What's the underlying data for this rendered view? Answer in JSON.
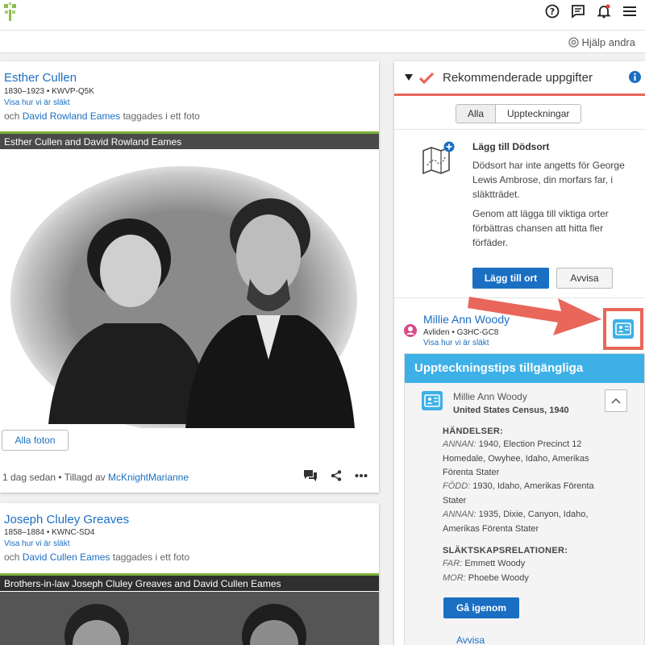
{
  "header": {
    "help_others": "Hjälp andra"
  },
  "cards": [
    {
      "name": "Esther Cullen",
      "meta": "1830–1923 • KWVP-Q5K",
      "relationship_link": "Visa hur vi är släkt",
      "tag_prefix": "och",
      "tag_person": "David Rowland Eames",
      "tag_suffix": "taggades i ett foto",
      "photo_caption": "Esther Cullen and David Rowland Eames",
      "all_photos": "Alla foton",
      "footer_time": "1 dag sedan • Tillagd av",
      "footer_user": "McKnightMarianne"
    },
    {
      "name": "Joseph Cluley Greaves",
      "meta": "1858–1884 • KWNC-SD4",
      "relationship_link": "Visa hur vi är släkt",
      "tag_prefix": "och",
      "tag_person": "David Cullen Eames",
      "tag_suffix": "taggades i ett foto",
      "photo_caption": "Brothers-in-law Joseph Cluley Greaves and David Cullen Eames"
    }
  ],
  "recommended": {
    "title": "Rekommenderade uppgifter",
    "tabs": [
      "Alla",
      "Uppteckningar"
    ],
    "task": {
      "title": "Lägg till Dödsort",
      "text1": "Dödsort har inte angetts för George Lewis Ambrose, din morfars far, i släktträdet.",
      "text2": "Genom att lägga till viktiga orter förbättras chansen att hitta fler förfäder.",
      "primary": "Lägg till ort",
      "secondary": "Avvisa"
    },
    "person": {
      "name": "Millie Ann Woody",
      "meta": "Avliden • G3HC-GC8",
      "relationship_link": "Visa hur vi är släkt"
    },
    "tips": {
      "title": "Uppteckningstips tillgängliga",
      "name": "Millie Ann Woody",
      "source": "United States Census, 1940",
      "events_heading": "HÄNDELSER:",
      "events": [
        {
          "label": "ANNAN:",
          "text": "1940, Election Precinct 12 Homedale, Owyhee, Idaho, Amerikas Förenta Stater"
        },
        {
          "label": "FÖDD:",
          "text": "1930, Idaho, Amerikas Förenta Stater"
        },
        {
          "label": "ANNAN:",
          "text": "1935, Dixie, Canyon, Idaho, Amerikas Förenta Stater"
        }
      ],
      "rel_heading": "SLÄKTSKAPSRELATIONER:",
      "relations": [
        {
          "label": "FAR:",
          "text": "Emmett Woody"
        },
        {
          "label": "MOR:",
          "text": "Phoebe Woody"
        }
      ],
      "review": "Gå igenom",
      "dismiss": "Avvisa"
    }
  },
  "colors": {
    "link": "#1b6fc2",
    "accent_red": "#e8675a",
    "tips_blue": "#3eb0e8",
    "photo_bar_green": "#7ab03a"
  }
}
